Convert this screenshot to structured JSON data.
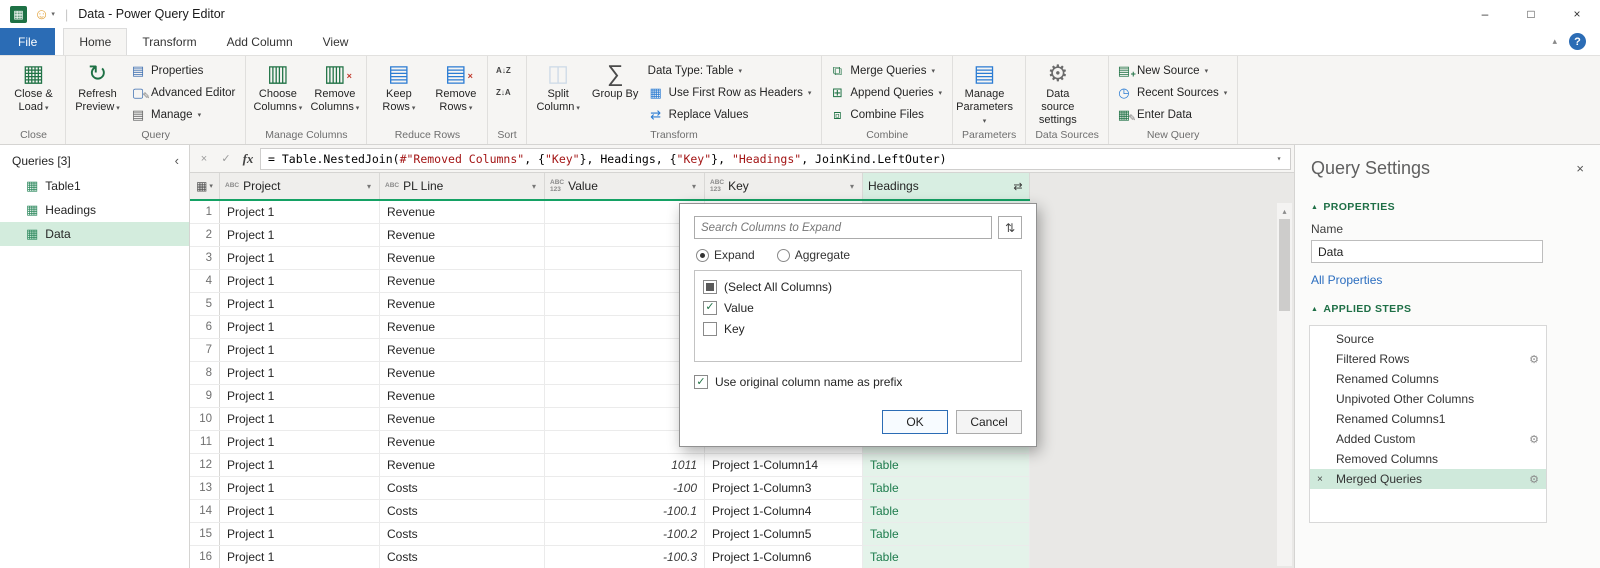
{
  "glyphs": {
    "section_tri": "▲",
    "gear": "⚙",
    "delete_step": "×",
    "scroll_up": "▴",
    "corner_table": "▦",
    "corner_arrow": "▾",
    "filter_arrow": "▾",
    "expand_column": "⇄",
    "query_table_icon": "▦",
    "check": "✓"
  },
  "titlebar": {
    "app_icon": "▦",
    "smiley": "☺",
    "title": "Data - Power Query Editor",
    "minimize": "–",
    "maximize": "□",
    "close": "×"
  },
  "ribbon_right": {
    "collapse": "▴",
    "help": "?"
  },
  "ribbon_tabs": [
    {
      "label": "File",
      "kind": "file"
    },
    {
      "label": "Home",
      "active": true
    },
    {
      "label": "Transform"
    },
    {
      "label": "Add Column"
    },
    {
      "label": "View"
    }
  ],
  "ribbon": {
    "groups": [
      {
        "label": "Close",
        "items": [
          {
            "kind": "big",
            "label": "Close & Load",
            "arrow": true,
            "icon": {
              "name": "close-and-load-icon",
              "glyph": "▦",
              "color": "#217346"
            }
          }
        ]
      },
      {
        "label": "Query",
        "items": [
          {
            "kind": "big",
            "label": "Refresh Preview",
            "arrow": true,
            "icon": {
              "name": "refresh-preview-icon",
              "glyph": "↻",
              "color": "#1e7145"
            }
          },
          {
            "kind": "col",
            "buttons": [
              {
                "label": "Properties",
                "icon": {
                  "name": "properties-icon",
                  "glyph": "▤",
                  "color": "#3e6fb0"
                }
              },
              {
                "label": "Advanced Editor",
                "icon": {
                  "name": "advanced-editor-icon",
                  "glyph": "▢",
                  "color": "#3e6fb0",
                  "overlay": "✎",
                  "ocolor": "#777777"
                }
              },
              {
                "label": "Manage",
                "arrow": true,
                "icon": {
                  "name": "manage-query-icon",
                  "glyph": "▤",
                  "color": "#666666"
                }
              }
            ]
          }
        ]
      },
      {
        "label": "Manage Columns",
        "items": [
          {
            "kind": "big",
            "label": "Choose Columns",
            "arrow": true,
            "icon": {
              "name": "choose-columns-icon",
              "glyph": "▥",
              "color": "#217346"
            }
          },
          {
            "kind": "big",
            "label": "Remove Columns",
            "arrow": true,
            "icon": {
              "name": "remove-columns-icon",
              "glyph": "▥",
              "color": "#217346",
              "overlay": "×",
              "ocolor": "#c0392b"
            }
          }
        ]
      },
      {
        "label": "Reduce Rows",
        "items": [
          {
            "kind": "big",
            "label": "Keep Rows",
            "arrow": true,
            "icon": {
              "name": "keep-rows-icon",
              "glyph": "▤",
              "color": "#2b7cd3"
            }
          },
          {
            "kind": "big",
            "label": "Remove Rows",
            "arrow": true,
            "icon": {
              "name": "remove-rows-icon",
              "glyph": "▤",
              "color": "#2b7cd3",
              "overlay": "×",
              "ocolor": "#c0392b"
            }
          }
        ]
      },
      {
        "label": "Sort",
        "items": [
          {
            "kind": "col",
            "buttons": [
              {
                "label": "",
                "icon": {
                  "name": "sort-ascending-icon",
                  "text": "A↓Z"
                }
              },
              {
                "label": "",
                "icon": {
                  "name": "sort-descending-icon",
                  "text": "Z↓A"
                }
              }
            ]
          }
        ]
      },
      {
        "label": "Transform",
        "items": [
          {
            "kind": "big",
            "label": "Split Column",
            "arrow": true,
            "disabled": true,
            "icon": {
              "name": "split-column-icon",
              "glyph": "◫",
              "color": "#9bb8d8"
            }
          },
          {
            "kind": "big",
            "label": "Group By",
            "icon": {
              "name": "group-by-icon",
              "glyph": "∑",
              "color": "#4a4a4a"
            }
          },
          {
            "kind": "col",
            "buttons": [
              {
                "label": "Data Type: Table",
                "arrow": true
              },
              {
                "label": "Use First Row as Headers",
                "arrow": true,
                "icon": {
                  "name": "use-first-row-as-headers-icon",
                  "glyph": "▦",
                  "color": "#2b7cd3"
                }
              },
              {
                "label": "Replace Values",
                "icon": {
                  "name": "replace-values-icon",
                  "glyph": "⇄",
                  "color": "#2b7cd3"
                }
              }
            ]
          }
        ]
      },
      {
        "label": "Combine",
        "items": [
          {
            "kind": "col",
            "buttons": [
              {
                "label": "Merge Queries",
                "arrow": true,
                "icon": {
                  "name": "merge-queries-icon",
                  "glyph": "⧉",
                  "color": "#217346"
                }
              },
              {
                "label": "Append Queries",
                "arrow": true,
                "icon": {
                  "name": "append-queries-icon",
                  "glyph": "⊞",
                  "color": "#217346"
                }
              },
              {
                "label": "Combine Files",
                "icon": {
                  "name": "combine-files-icon",
                  "glyph": "⧈",
                  "color": "#217346"
                }
              }
            ]
          }
        ]
      },
      {
        "label": "Parameters",
        "items": [
          {
            "kind": "big",
            "label": "Manage Parameters",
            "arrow": true,
            "icon": {
              "name": "manage-parameters-icon",
              "glyph": "▤",
              "color": "#2b7cd3"
            }
          }
        ]
      },
      {
        "label": "Data Sources",
        "items": [
          {
            "kind": "big",
            "label": "Data source settings",
            "icon": {
              "name": "data-source-settings-icon",
              "glyph": "⚙",
              "color": "#6b6b6b"
            }
          }
        ]
      },
      {
        "label": "New Query",
        "items": [
          {
            "kind": "col",
            "buttons": [
              {
                "label": "New Source",
                "arrow": true,
                "icon": {
                  "name": "new-source-icon",
                  "glyph": "▤",
                  "color": "#217346",
                  "overlay": "+",
                  "ocolor": "#217346"
                }
              },
              {
                "label": "Recent Sources",
                "arrow": true,
                "icon": {
                  "name": "recent-sources-icon",
                  "glyph": "◷",
                  "color": "#2b7cd3"
                }
              },
              {
                "label": "Enter Data",
                "icon": {
                  "name": "enter-data-icon",
                  "glyph": "▦",
                  "color": "#217346",
                  "overlay": "✎",
                  "ocolor": "#777777"
                }
              }
            ]
          }
        ]
      }
    ]
  },
  "queries_pane": {
    "header": "Queries [3]",
    "collapse_icon": "‹",
    "items": [
      {
        "label": "Table1"
      },
      {
        "label": "Headings"
      },
      {
        "label": "Data",
        "selected": true
      }
    ]
  },
  "formula": {
    "cancel_icon": "×",
    "accept_icon": "✓",
    "fx": "fx",
    "expand_icon": "▾",
    "segments": [
      {
        "t": "= ",
        "c": "plain"
      },
      {
        "t": "Table.NestedJoin(",
        "c": "plain"
      },
      {
        "t": "#\"Removed Columns\"",
        "c": "string"
      },
      {
        "t": ", {",
        "c": "plain"
      },
      {
        "t": "\"Key\"",
        "c": "string"
      },
      {
        "t": "}, Headings, {",
        "c": "plain"
      },
      {
        "t": "\"Key\"",
        "c": "string"
      },
      {
        "t": "}, ",
        "c": "plain"
      },
      {
        "t": "\"Headings\"",
        "c": "string"
      },
      {
        "t": ", JoinKind.LeftOuter)",
        "c": "plain"
      }
    ]
  },
  "grid": {
    "columns": [
      {
        "name": "Project",
        "type_icon": "ABC"
      },
      {
        "name": "PL Line",
        "type_icon": "ABC"
      },
      {
        "name": "Value",
        "type_icon": "ABC|123"
      },
      {
        "name": "Key",
        "type_icon": "ABC|123"
      },
      {
        "name": "Headings",
        "type_icon": "",
        "selected": true,
        "expand_icon": true
      }
    ],
    "rows": [
      {
        "n": 1,
        "cells": [
          "Project 1",
          "Revenue",
          "",
          "",
          ""
        ]
      },
      {
        "n": 2,
        "cells": [
          "Project 1",
          "Revenue",
          "",
          "",
          ""
        ]
      },
      {
        "n": 3,
        "cells": [
          "Project 1",
          "Revenue",
          "",
          "",
          ""
        ]
      },
      {
        "n": 4,
        "cells": [
          "Project 1",
          "Revenue",
          "",
          "",
          ""
        ]
      },
      {
        "n": 5,
        "cells": [
          "Project 1",
          "Revenue",
          "",
          "",
          ""
        ]
      },
      {
        "n": 6,
        "cells": [
          "Project 1",
          "Revenue",
          "",
          "",
          ""
        ]
      },
      {
        "n": 7,
        "cells": [
          "Project 1",
          "Revenue",
          "",
          "",
          ""
        ]
      },
      {
        "n": 8,
        "cells": [
          "Project 1",
          "Revenue",
          "",
          "",
          ""
        ]
      },
      {
        "n": 9,
        "cells": [
          "Project 1",
          "Revenue",
          "",
          "",
          ""
        ]
      },
      {
        "n": 10,
        "cells": [
          "Project 1",
          "Revenue",
          "",
          "",
          ""
        ]
      },
      {
        "n": 11,
        "cells": [
          "Project 1",
          "Revenue",
          "",
          "",
          ""
        ]
      },
      {
        "n": 12,
        "cells": [
          "Project 1",
          "Revenue",
          "1011",
          "Project 1-Column14",
          "Table"
        ]
      },
      {
        "n": 13,
        "cells": [
          "Project 1",
          "Costs",
          "-100",
          "Project 1-Column3",
          "Table"
        ]
      },
      {
        "n": 14,
        "cells": [
          "Project 1",
          "Costs",
          "-100.1",
          "Project 1-Column4",
          "Table"
        ]
      },
      {
        "n": 15,
        "cells": [
          "Project 1",
          "Costs",
          "-100.2",
          "Project 1-Column5",
          "Table"
        ]
      },
      {
        "n": 16,
        "cells": [
          "Project 1",
          "Costs",
          "-100.3",
          "Project 1-Column6",
          "Table"
        ]
      }
    ]
  },
  "dialog": {
    "search_placeholder": "Search Columns to Expand",
    "sort_icon": "⇅",
    "radios": [
      {
        "label": "Expand",
        "selected": true
      },
      {
        "label": "Aggregate",
        "selected": false
      }
    ],
    "columns": [
      {
        "label": "(Select All Columns)",
        "state": "indeterminate"
      },
      {
        "label": "Value",
        "state": "checked"
      },
      {
        "label": "Key",
        "state": "unchecked"
      }
    ],
    "prefix_label": "Use original column name as prefix",
    "prefix_checked": true,
    "ok": "OK",
    "cancel": "Cancel"
  },
  "settings": {
    "title": "Query Settings",
    "close_icon": "×",
    "properties_header": "PROPERTIES",
    "name_label": "Name",
    "name_value": "Data",
    "all_properties": "All Properties",
    "steps_header": "APPLIED STEPS",
    "steps": [
      {
        "label": "Source"
      },
      {
        "label": "Filtered Rows",
        "gear": true
      },
      {
        "label": "Renamed Columns"
      },
      {
        "label": "Unpivoted Other Columns"
      },
      {
        "label": "Renamed Columns1"
      },
      {
        "label": "Added Custom",
        "gear": true
      },
      {
        "label": "Removed Columns"
      },
      {
        "label": "Merged Queries",
        "gear": true,
        "selected": true
      }
    ]
  }
}
